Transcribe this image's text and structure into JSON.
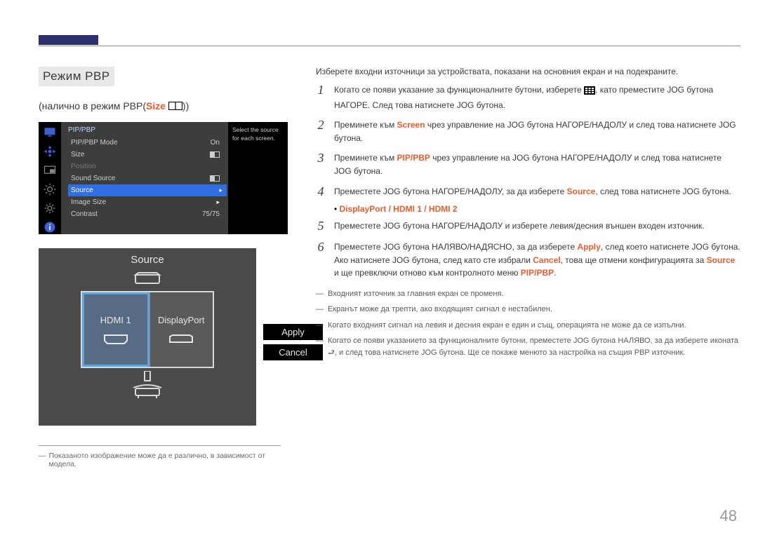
{
  "page_number": "48",
  "section_title": "Режим PBP",
  "subtitle_prefix": "(налично в режим PBP(",
  "subtitle_size": "Size",
  "subtitle_suffix": "))",
  "osd": {
    "title": "PIP/PBP",
    "side_hint": "Select the source for each screen.",
    "rows": [
      {
        "label": "PIP/PBP Mode",
        "value": "On"
      },
      {
        "label": "Size"
      },
      {
        "label": "Position",
        "dim": true
      },
      {
        "label": "Sound Source"
      },
      {
        "label": "Source",
        "selected": true
      },
      {
        "label": "Image Size"
      },
      {
        "label": "Contrast",
        "value": "75/75"
      }
    ]
  },
  "source_panel": {
    "title": "Source",
    "left": "HDMI 1",
    "right": "DisplayPort",
    "apply": "Apply",
    "cancel": "Cancel"
  },
  "footnote": "Показаното изображение може да е различно, в зависимост от модела.",
  "intro": "Изберете входни източници за устройствата, показани на основния екран и на подекраните.",
  "steps": {
    "s1a": "Когато се появи указание за функционалните бутони, изберете ",
    "s1b": ", като преместите JOG бутона НАГОРЕ. След това натиснете JOG бутона.",
    "s2a": "Преминете към ",
    "s2kw": "Screen",
    "s2b": " чрез управление на JOG бутона НАГОРЕ/НАДОЛУ и след това натиснете JOG бутона.",
    "s3a": "Преминете към ",
    "s3kw": "PIP/PBP",
    "s3b": " чрез управление на JOG бутона НАГОРЕ/НАДОЛУ и след това натиснете JOG бутона.",
    "s4a": "Преместете JOG бутона НАГОРЕ/НАДОЛУ, за да изберете ",
    "s4kw": "Source",
    "s4b": ", след това натиснете JOG бутона.",
    "opt": "DisplayPort / HDMI 1 / HDMI 2",
    "s5": "Преместете JOG бутона НАГОРЕ/НАДОЛУ и изберете левия/десния външен входен източник.",
    "s6a": "Преместете JOG бутона НАЛЯВО/НАДЯСНО, за да изберете ",
    "s6kw1": "Apply",
    "s6b": ", след което натиснете JOG бутона. Ако натиснете JOG бутона, след като сте избрали ",
    "s6kw2": "Cancel",
    "s6c": ", това ще отмени конфигурацията за ",
    "s6kw3": "Source",
    "s6d": " и ще превключи отново към контролното меню ",
    "s6kw4": "PIP/PBP",
    "s6e": "."
  },
  "notes": [
    "Входният източник за главния екран се променя.",
    "Екранът може да трепти, ако входящият сигнал е нестабилен.",
    "Когато входният сигнал на левия и десния екран е един и същ, операцията не може да се изпълни.",
    "Когато се появи указанието за функционалните бутони, преместете JOG бутона НАЛЯВО, за да изберете иконата ⮐, и след това натиснете JOG бутона. Ще се покаже менюто за настройка на същия PBP източник."
  ]
}
